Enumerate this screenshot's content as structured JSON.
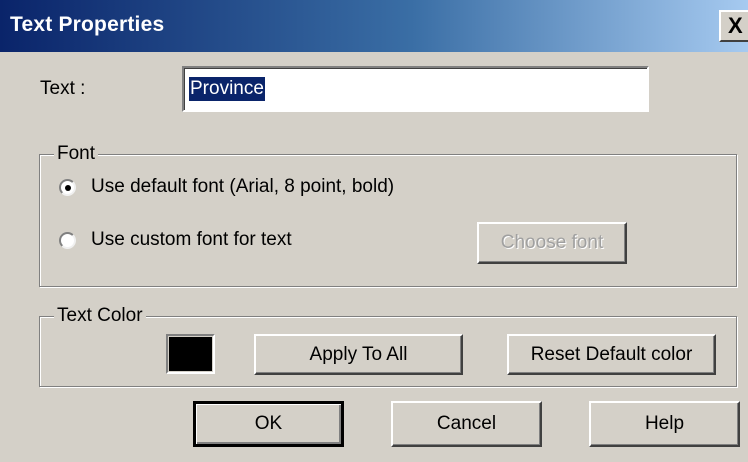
{
  "window": {
    "title": "Text Properties",
    "close_icon": "close-icon",
    "close_glyph": "X"
  },
  "text_field": {
    "label": "Text :",
    "value": "Province"
  },
  "font_group": {
    "legend": "Font",
    "options": [
      {
        "label": "Use default font (Arial, 8 point, bold)",
        "selected": true
      },
      {
        "label": "Use custom font for text",
        "selected": false
      }
    ],
    "choose_font_label": "Choose font",
    "choose_font_enabled": false
  },
  "color_group": {
    "legend": "Text Color",
    "swatch_color": "#000000",
    "apply_label": "Apply To All",
    "reset_label": "Reset Default color"
  },
  "footer": {
    "ok_label": "OK",
    "cancel_label": "Cancel",
    "help_label": "Help"
  },
  "colors": {
    "title_gradient_start": "#0a246a",
    "title_gradient_end": "#a6caf0",
    "dialog_face": "#d4d0c8",
    "selection": "#0a246a"
  }
}
